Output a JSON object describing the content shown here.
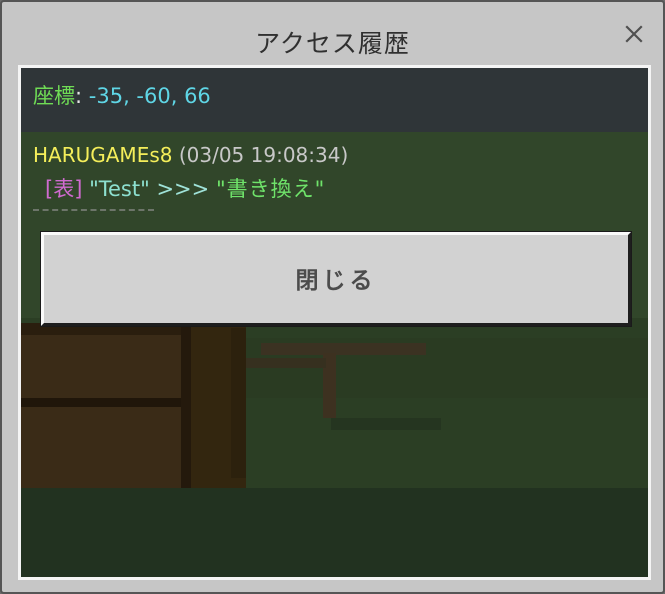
{
  "dialog": {
    "title": "アクセス履歴",
    "close_icon": "close-icon"
  },
  "coordinates": {
    "label": "座標",
    "separator": ":",
    "value": "-35, -60, 66"
  },
  "log": {
    "player": "HARUGAMEs8",
    "timestamp": "(03/05 19:08:34)",
    "side": "[表]",
    "old_value": "\"Test\"",
    "arrow": ">>>",
    "new_value": "\"書き換え\""
  },
  "buttons": {
    "close_label": "閉じる"
  },
  "colors": {
    "coord_label": "#6fdc55",
    "coord_value": "#5fd6e6",
    "player": "#f4ee5a",
    "timestamp": "#c8c8c8",
    "side": "#d06ad0",
    "new_value": "#6fe36a"
  }
}
